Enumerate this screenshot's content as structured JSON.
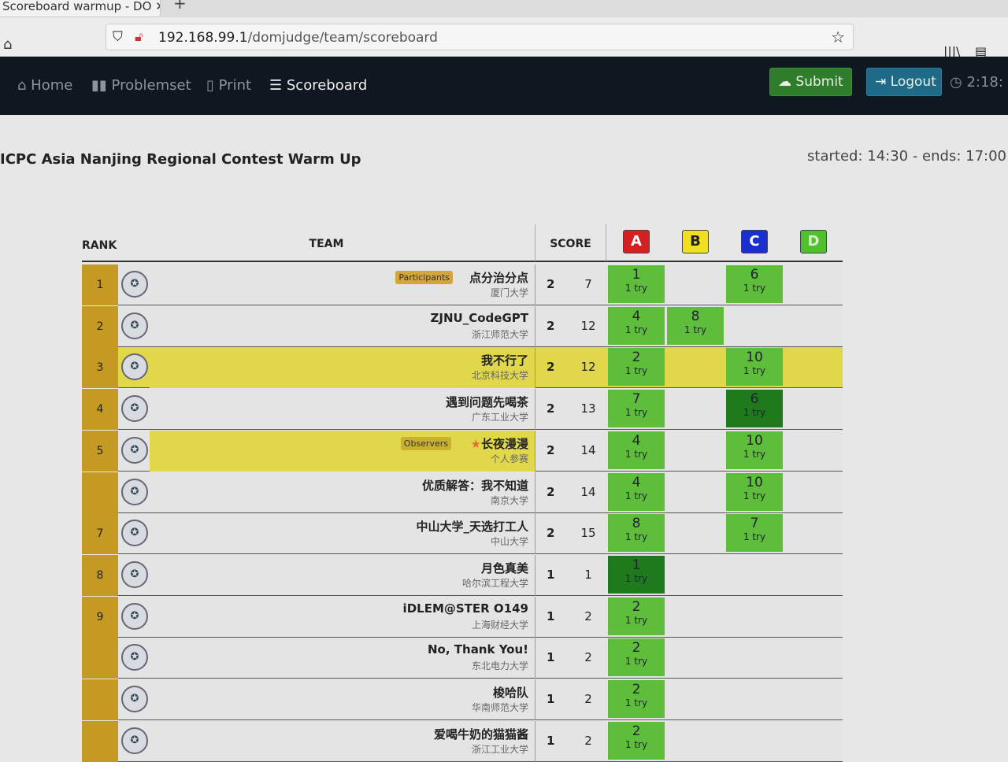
{
  "browser": {
    "tab_title": "Scoreboard warmup - DO",
    "url_host": "192.168.99.1",
    "url_path": "/domjudge/team/scoreboard"
  },
  "nav": {
    "items": [
      {
        "icon": "home-icon",
        "label": "Home"
      },
      {
        "icon": "book-icon",
        "label": "Problemset"
      },
      {
        "icon": "file-icon",
        "label": "Print"
      },
      {
        "icon": "list-ordered-icon",
        "label": "Scoreboard",
        "active": true
      }
    ],
    "submit": "Submit",
    "logout": "Logout",
    "clock": "2:18:"
  },
  "contest": {
    "title": "ICPC Asia Nanjing Regional Contest Warm Up",
    "times": "started: 14:30 - ends: 17:00"
  },
  "table": {
    "headers": {
      "rank": "RANK",
      "team": "TEAM",
      "score": "SCORE"
    },
    "problems": [
      {
        "label": "A",
        "color": "#d42020",
        "text": "#fff"
      },
      {
        "label": "B",
        "color": "#f0e020",
        "text": "#222"
      },
      {
        "label": "C",
        "color": "#1a2fd0",
        "text": "#fff"
      },
      {
        "label": "D",
        "color": "#50c030",
        "text": "#d8f0c8"
      }
    ],
    "colors": {
      "solved": "#5fbd3c",
      "first_solved": "#1f7a1e",
      "rank_bg": "#c59a22",
      "highlight": "#e0d84a"
    },
    "rows": [
      {
        "rank": "1",
        "name": "点分治分点",
        "aff": "厦门大学",
        "badge": "Participants",
        "solved": "2",
        "penalty": "7",
        "cells": {
          "A": {
            "time": "1",
            "tries": "1 try"
          },
          "C": {
            "time": "6",
            "tries": "1 try"
          }
        }
      },
      {
        "rank": "2",
        "name": "ZJNU_CodeGPT",
        "aff": "浙江师范大学",
        "solved": "2",
        "penalty": "12",
        "cells": {
          "A": {
            "time": "4",
            "tries": "1 try"
          },
          "B": {
            "time": "8",
            "tries": "1 try"
          }
        }
      },
      {
        "rank": "3",
        "name": "我不行了",
        "aff": "北京科技大学",
        "solved": "2",
        "penalty": "12",
        "highlight": "full",
        "cells": {
          "A": {
            "time": "2",
            "tries": "1 try"
          },
          "C": {
            "time": "10",
            "tries": "1 try"
          }
        }
      },
      {
        "rank": "4",
        "name": "遇到问题先喝茶",
        "aff": "广东工业大学",
        "solved": "2",
        "penalty": "13",
        "cells": {
          "A": {
            "time": "7",
            "tries": "1 try"
          },
          "C": {
            "time": "6",
            "tries": "1 try",
            "first": true
          }
        }
      },
      {
        "rank": "5",
        "name": "长夜漫漫",
        "aff": "个人参赛",
        "badge": "Observers",
        "star": "★",
        "solved": "2",
        "penalty": "14",
        "highlight": "team",
        "cells": {
          "A": {
            "time": "4",
            "tries": "1 try"
          },
          "C": {
            "time": "10",
            "tries": "1 try"
          }
        }
      },
      {
        "rank": "",
        "name": "优质解答：我不知道",
        "aff": "南京大学",
        "solved": "2",
        "penalty": "14",
        "cells": {
          "A": {
            "time": "4",
            "tries": "1 try"
          },
          "C": {
            "time": "10",
            "tries": "1 try"
          }
        }
      },
      {
        "rank": "7",
        "name": "中山大学_天选打工人",
        "aff": "中山大学",
        "solved": "2",
        "penalty": "15",
        "cells": {
          "A": {
            "time": "8",
            "tries": "1 try"
          },
          "C": {
            "time": "7",
            "tries": "1 try"
          }
        }
      },
      {
        "rank": "8",
        "name": "月色真美",
        "aff": "哈尔滨工程大学",
        "solved": "1",
        "penalty": "1",
        "cells": {
          "A": {
            "time": "1",
            "tries": "1 try",
            "first": true
          }
        }
      },
      {
        "rank": "9",
        "name": "iDLEM@STER O149",
        "aff": "上海财经大学",
        "solved": "1",
        "penalty": "2",
        "cells": {
          "A": {
            "time": "2",
            "tries": "1 try"
          }
        }
      },
      {
        "rank": "",
        "name": "No, Thank You!",
        "aff": "东北电力大学",
        "solved": "1",
        "penalty": "2",
        "cells": {
          "A": {
            "time": "2",
            "tries": "1 try"
          }
        }
      },
      {
        "rank": "",
        "name": "梭哈队",
        "aff": "华南师范大学",
        "solved": "1",
        "penalty": "2",
        "cells": {
          "A": {
            "time": "2",
            "tries": "1 try"
          }
        }
      },
      {
        "rank": "",
        "name": "爱喝牛奶的猫猫酱",
        "aff": "浙江工业大学",
        "solved": "1",
        "penalty": "2",
        "cells": {
          "A": {
            "time": "2",
            "tries": "1 try"
          }
        }
      }
    ]
  }
}
